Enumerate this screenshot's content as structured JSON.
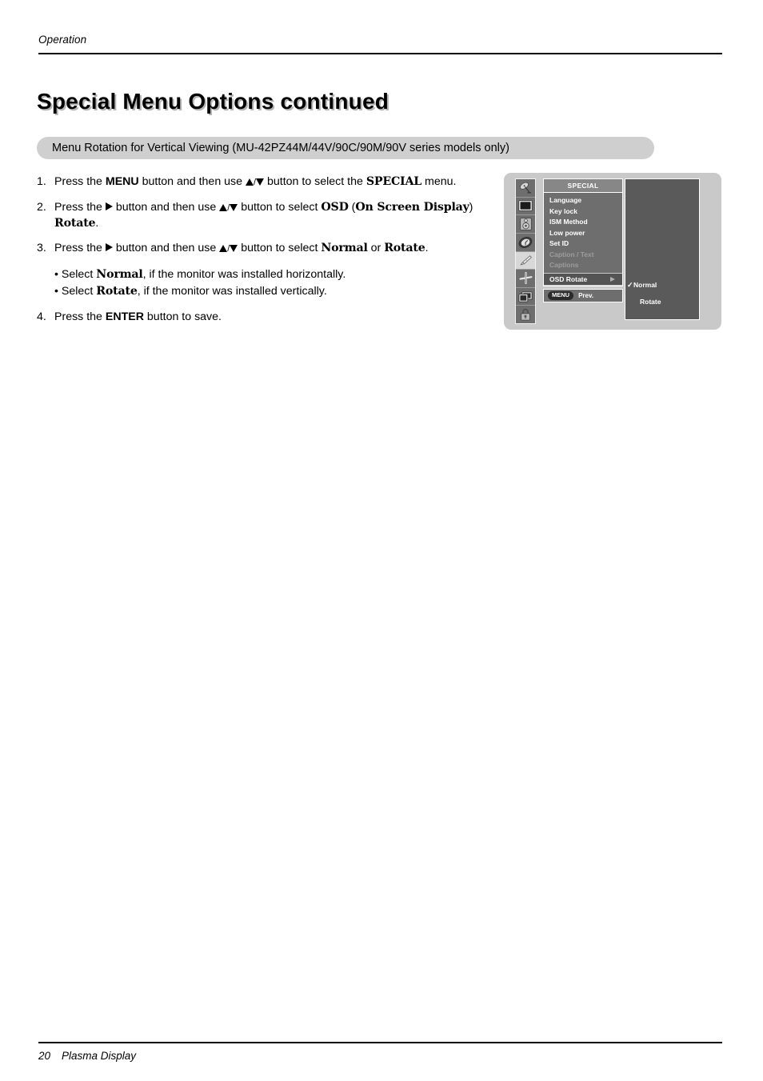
{
  "running_head": "Operation",
  "page_title": "Special Menu Options continued",
  "section": {
    "label": "Menu Rotation for Vertical Viewing (MU-42PZ44M/44V/90C/90M/90V series models only)"
  },
  "steps": [
    {
      "num": "1.",
      "p1": "Press the ",
      "strong1": "MENU",
      "p2": " button and then use ",
      "sep": "/",
      "p3": " button to select the ",
      "strong2": "SPECIAL",
      "p4": " menu."
    },
    {
      "num": "2.",
      "p1": "Press the ",
      "p2": " button and then use ",
      "sep": "/",
      "p3": " button to select ",
      "strong1": "OSD",
      "p4": " (",
      "strong2": "On Screen Display",
      "p5": ")",
      "strong3": "Rotate",
      "p6": "."
    },
    {
      "num": "3.",
      "p1": "Press the ",
      "p2": " button and then use ",
      "sep": "/",
      "p3": " button to select ",
      "strong1": "Normal",
      "p4": " or ",
      "strong2": "Rotate",
      "p5": "."
    }
  ],
  "bullets": [
    {
      "marker": "•",
      "p1": " Select ",
      "strong": "Normal",
      "p2": ", if the monitor was installed horizontally."
    },
    {
      "marker": "•",
      "p1": " Select ",
      "strong": "Rotate",
      "p2": ", if the monitor was installed vertically."
    }
  ],
  "step4": {
    "num": "4.",
    "p1": "Press the ",
    "strong": "ENTER",
    "p2": " button to save."
  },
  "osd": {
    "title": "SPECIAL",
    "icons": [
      {
        "name": "antenna-icon",
        "label": "Antenna"
      },
      {
        "name": "picture-icon",
        "label": "Picture"
      },
      {
        "name": "sound-icon",
        "label": "Sound"
      },
      {
        "name": "timer-icon",
        "label": "Timer"
      },
      {
        "name": "special-icon",
        "label": "Special"
      },
      {
        "name": "screen-icon",
        "label": "Screen"
      },
      {
        "name": "pip-icon",
        "label": "PIP"
      },
      {
        "name": "lock-icon",
        "label": "Lock"
      }
    ],
    "menu_items": [
      {
        "label": "Language",
        "state": "normal"
      },
      {
        "label": "Key lock",
        "state": "normal"
      },
      {
        "label": "ISM Method",
        "state": "normal"
      },
      {
        "label": "Low power",
        "state": "normal"
      },
      {
        "label": "Set ID",
        "state": "normal"
      },
      {
        "label": "Caption / Text",
        "state": "disabled"
      },
      {
        "label": "Captions",
        "state": "disabled"
      },
      {
        "label": "OSD Rotate",
        "state": "selected"
      }
    ],
    "footer": {
      "key": "MENU",
      "action": "Prev."
    },
    "values": [
      {
        "tick": "✓",
        "label": "Normal"
      },
      {
        "tick": "",
        "label": "Rotate"
      }
    ]
  },
  "footer": {
    "page_number": "20",
    "product": "Plasma Display"
  },
  "colors": {
    "pill_bg": "#cfcfcf",
    "osd_frame_bg": "#c9c9c9",
    "osd_panel_bg": "#6e6e6e",
    "osd_title_bg": "#878787",
    "osd_value_bg": "#5a5a5a",
    "osd_selected_bg": "#545454",
    "osd_disabled_text": "#9d9d9d"
  }
}
